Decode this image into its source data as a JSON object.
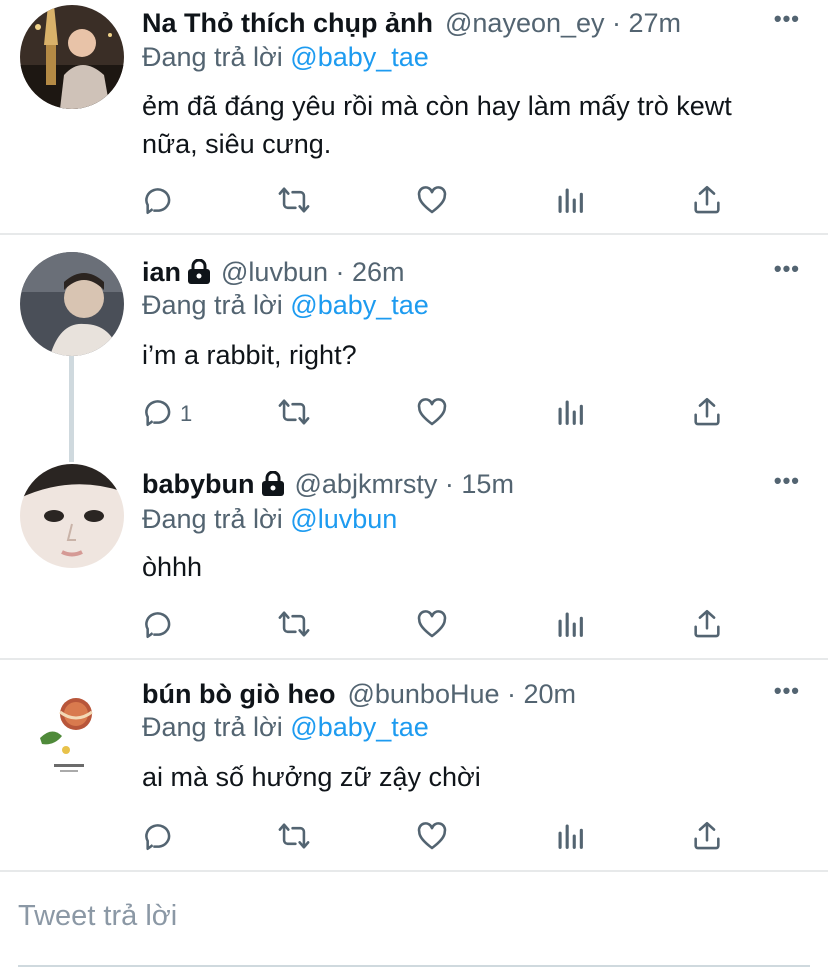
{
  "replying_label": "Đang trả lời",
  "tweets": [
    {
      "display_name": "Na Thỏ thích chụp ảnh",
      "handle": "@nayeon_ey · 27m",
      "replying_to": "@baby_tae",
      "text": "ẻm đã đáng yêu rồi mà còn hay làm mấy trò kewt nữa, siêu cưng.",
      "reply_count": ""
    },
    {
      "display_name": "ian",
      "handle": "@luvbun · 26m",
      "replying_to": "@baby_tae",
      "text": "i’m a rabbit, right?",
      "reply_count": "1"
    },
    {
      "display_name": "babybun",
      "handle": "@abjkmrsty · 15m",
      "replying_to": "@luvbun",
      "text": "òhhh",
      "reply_count": ""
    },
    {
      "display_name": "bún bò giò heo",
      "handle": "@bunboHue · 20m",
      "replying_to": "@baby_tae",
      "text": "ai mà số hưởng zữ zậy chời",
      "reply_count": ""
    }
  ],
  "reply_box": {
    "placeholder": "Tweet trả lời"
  },
  "colors": {
    "mention": "#1d9bf0",
    "secondary": "#536471",
    "separator": "#e7e9ea"
  },
  "icons": [
    "reply-icon",
    "retweet-icon",
    "like-icon",
    "analytics-icon",
    "share-icon",
    "lock-icon",
    "more-icon"
  ]
}
